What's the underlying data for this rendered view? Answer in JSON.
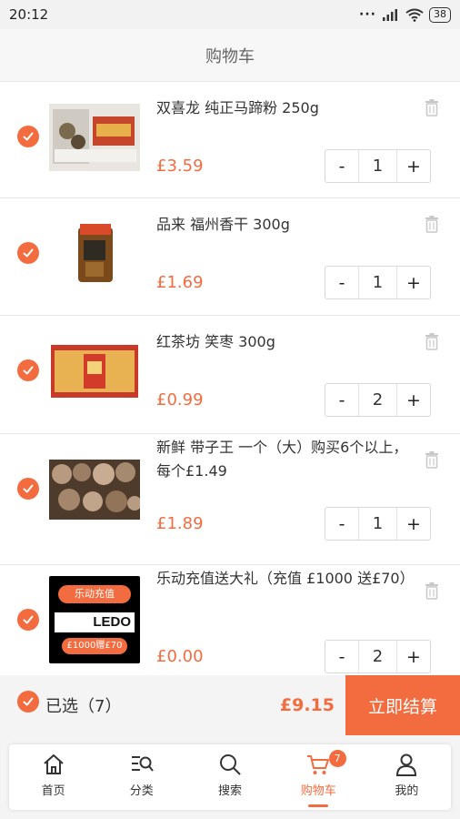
{
  "status_bar": {
    "time": "20:12",
    "battery": "38"
  },
  "header": {
    "title": "购物车"
  },
  "cart": {
    "items": [
      {
        "name": "双喜龙 纯正马蹄粉 250g",
        "price": "£3.59",
        "qty": "1",
        "minus": "-",
        "plus": "+",
        "image_icon": "product-image"
      },
      {
        "name": "品来 福州香干 300g",
        "price": "£1.69",
        "qty": "1",
        "minus": "-",
        "plus": "+",
        "image_icon": "product-image"
      },
      {
        "name": "红茶坊 笑枣 300g",
        "price": "£0.99",
        "qty": "2",
        "minus": "-",
        "plus": "+",
        "image_icon": "product-image"
      },
      {
        "name": "新鲜 带子王 一个（大）购买6个以上，每个£1.49",
        "price": "£1.89",
        "qty": "1",
        "minus": "-",
        "plus": "+",
        "image_icon": "product-image"
      },
      {
        "name": "乐动充值送大礼（充值 £1000 送£70）",
        "price": "£0.00",
        "qty": "2",
        "minus": "-",
        "plus": "+",
        "image_icon": "product-image"
      }
    ],
    "promo_image": {
      "line1": "乐动充值",
      "brand": "LEDO",
      "line2": "£1000赠£70"
    }
  },
  "checkout": {
    "selected_label": "已选（7）",
    "total": "£9.15",
    "checkout_label": "立即结算"
  },
  "tabs": [
    {
      "label": "首页",
      "icon": "home-icon"
    },
    {
      "label": "分类",
      "icon": "category-icon"
    },
    {
      "label": "搜索",
      "icon": "search-icon"
    },
    {
      "label": "购物车",
      "icon": "cart-icon",
      "badge": "7",
      "active": true
    },
    {
      "label": "我的",
      "icon": "profile-icon"
    }
  ],
  "colors": {
    "accent": "#f36c3f",
    "text": "#333333",
    "background": "#f4f4f4"
  }
}
